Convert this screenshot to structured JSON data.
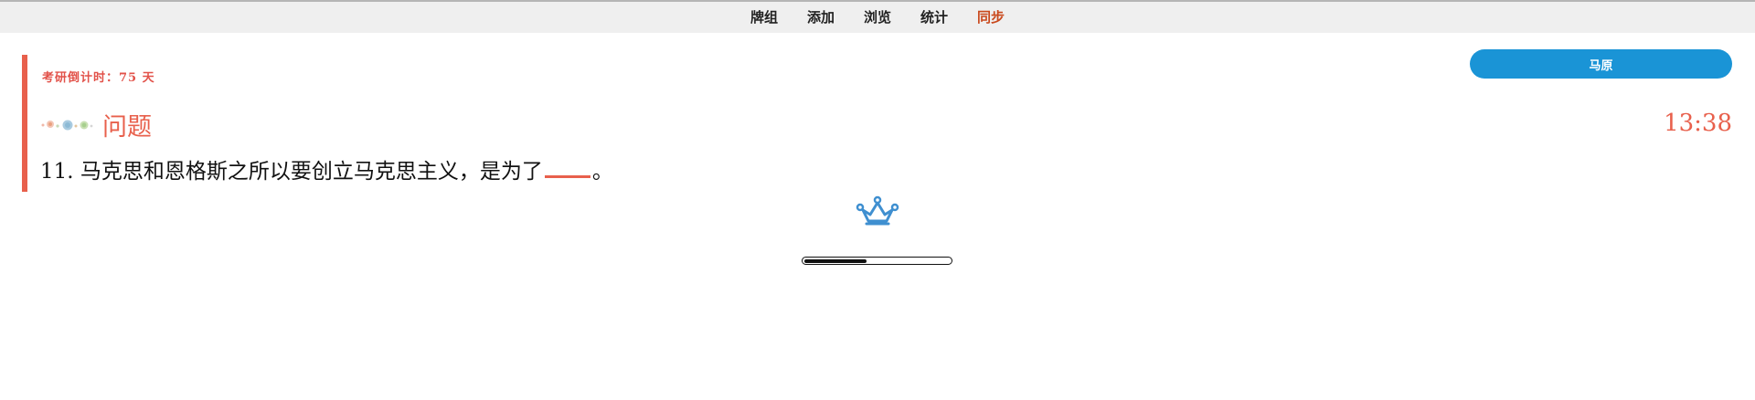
{
  "nav": {
    "items": [
      {
        "label": "牌组"
      },
      {
        "label": "添加"
      },
      {
        "label": "浏览"
      },
      {
        "label": "统计"
      },
      {
        "label": "同步"
      }
    ]
  },
  "countdown": {
    "text": "考研倒计时：75 天"
  },
  "subject_button": {
    "label": "马原"
  },
  "question_header": {
    "title": "问题",
    "clock": "13:38"
  },
  "question": {
    "text_before": "11. 马克思和恩格斯之所以要创立马克思主义，是为了",
    "text_after": "。"
  },
  "progress": {
    "fraction": 0.43
  },
  "colors": {
    "accent": "#e8604c",
    "button_blue": "#1a94d6",
    "sync": "#c9491d",
    "crown_blue": "#3f8fd0"
  },
  "icons": {
    "crown": "crown-icon",
    "dots": "decorative-dots-icon"
  }
}
